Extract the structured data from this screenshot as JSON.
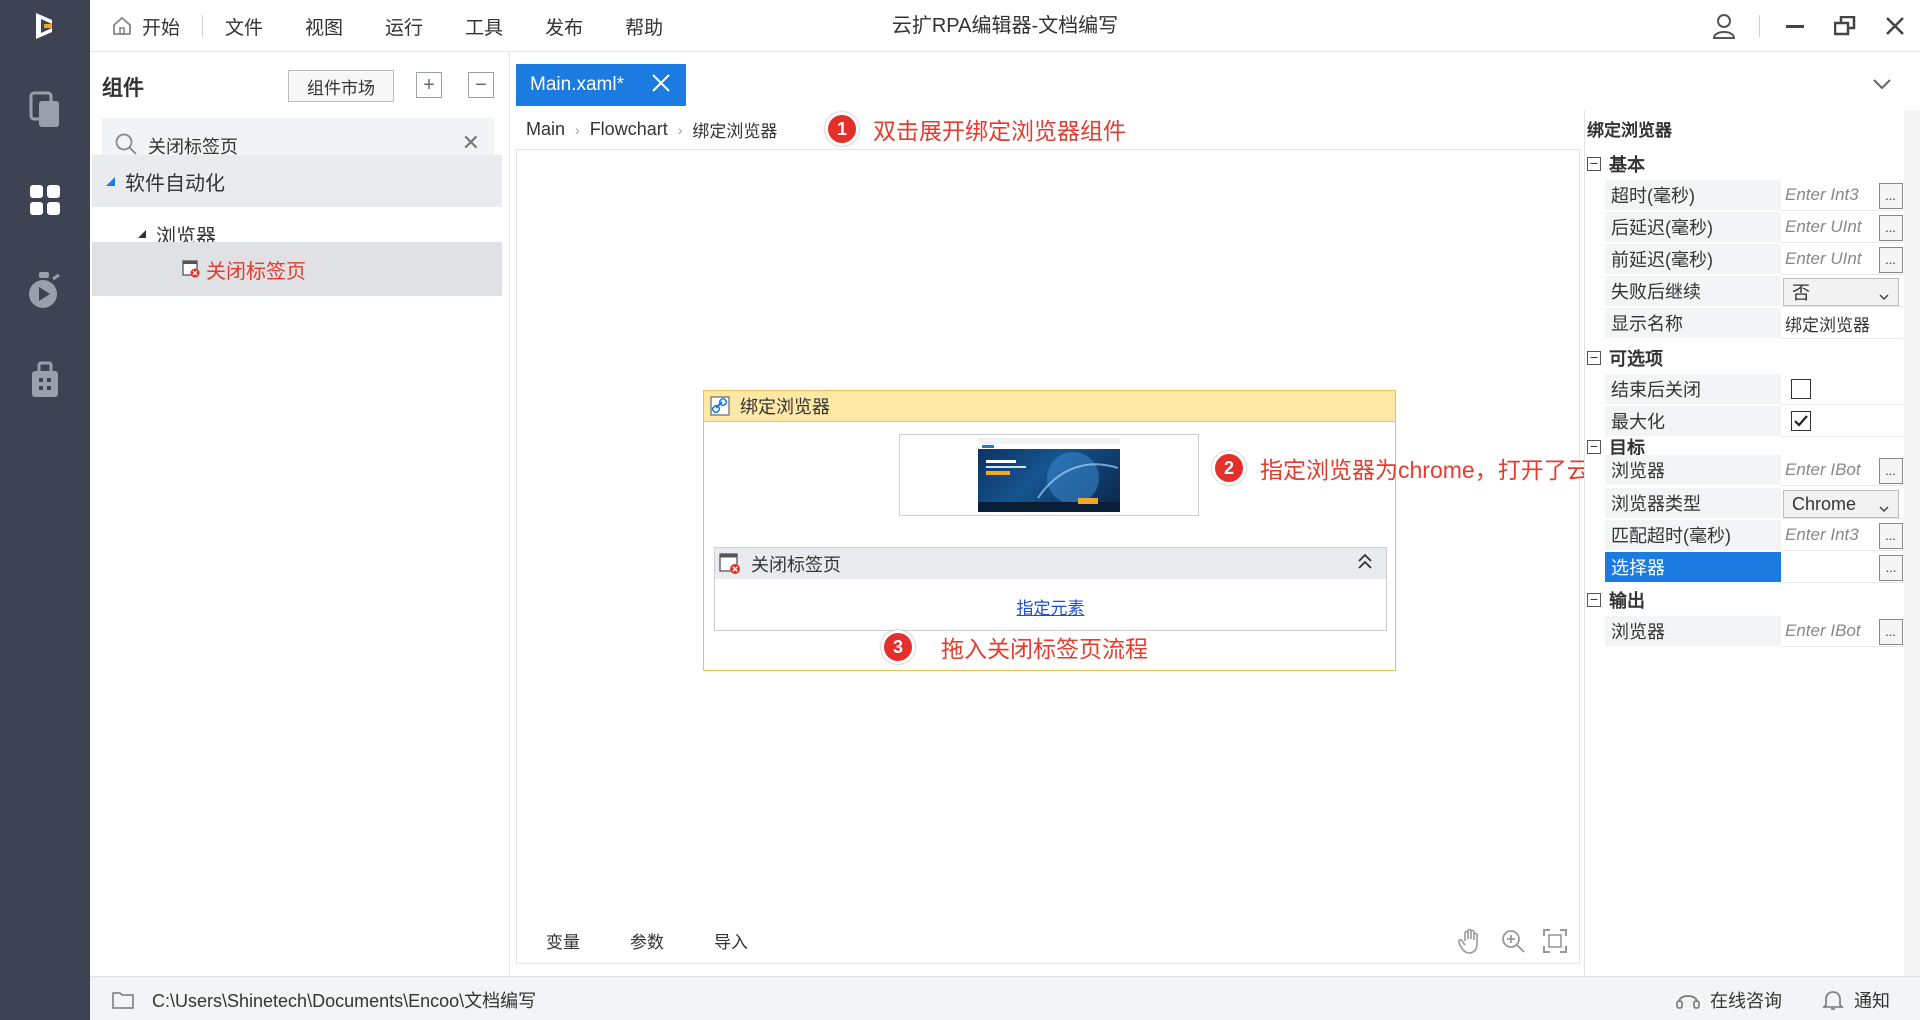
{
  "menu": {
    "home": "开始",
    "items": [
      "文件",
      "视图",
      "运行",
      "工具",
      "发布",
      "帮助"
    ]
  },
  "app_title": "云扩RPA编辑器-文档编写",
  "rail": {
    "items": [
      "documents-icon",
      "components-icon",
      "robot-icon",
      "package-icon"
    ]
  },
  "components": {
    "title": "组件",
    "market_button": "组件市场",
    "search_value": "关闭标签页",
    "tree": {
      "group": "软件自动化",
      "subgroup": "浏览器",
      "leaf": "关闭标签页"
    }
  },
  "editor": {
    "tab_label": "Main.xaml*",
    "breadcrumb": [
      "Main",
      "Flowchart",
      "绑定浏览器"
    ],
    "annotations": [
      {
        "num": "1",
        "text": "双击展开绑定浏览器组件"
      },
      {
        "num": "2",
        "text": "指定浏览器为chrome，打开了云扩官网和云扩学院首页"
      },
      {
        "num": "3",
        "text": "拖入关闭标签页流程"
      }
    ],
    "activity": {
      "title": "绑定浏览器",
      "child_title": "关闭标签页",
      "child_link": "指定元素"
    },
    "bottom_tabs": [
      "变量",
      "参数",
      "导入"
    ]
  },
  "properties": {
    "title": "绑定浏览器",
    "sections": {
      "basic": "基本",
      "optional": "可选项",
      "target": "目标",
      "output": "输出"
    },
    "basic": [
      {
        "name": "超时(毫秒)",
        "value": "Enter Int3"
      },
      {
        "name": "后延迟(毫秒)",
        "value": "Enter UInt"
      },
      {
        "name": "前延迟(毫秒)",
        "value": "Enter UInt"
      },
      {
        "name": "失败后继续",
        "value": "否"
      },
      {
        "name": "显示名称",
        "value": "绑定浏览器"
      }
    ],
    "optional": [
      {
        "name": "结束后关闭",
        "checked": false
      },
      {
        "name": "最大化",
        "checked": true
      }
    ],
    "target": [
      {
        "name": "浏览器",
        "value": "Enter IBot"
      },
      {
        "name": "浏览器类型",
        "value": "Chrome"
      },
      {
        "name": "匹配超时(毫秒)",
        "value": "Enter Int3"
      },
      {
        "name": "选择器",
        "value": ""
      }
    ],
    "output": [
      {
        "name": "浏览器",
        "value": "Enter IBot"
      }
    ],
    "ellipsis": "..."
  },
  "status": {
    "path": "C:\\Users\\Shinetech\\Documents\\Encoo\\文档编写",
    "consult": "在线咨询",
    "notify": "通知"
  },
  "colors": {
    "rail_bg": "#3d4353",
    "accent": "#1b7be0",
    "annotation_red": "#e63b2e",
    "activity_header": "#fde8a6"
  }
}
